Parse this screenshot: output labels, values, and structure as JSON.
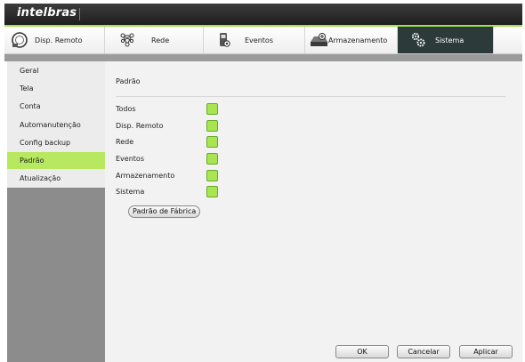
{
  "brand": {
    "logo": "intelbras"
  },
  "tabs": [
    {
      "label": "Disp. Remoto",
      "icon": "remote-device-icon"
    },
    {
      "label": "Rede",
      "icon": "network-icon"
    },
    {
      "label": "Eventos",
      "icon": "events-icon"
    },
    {
      "label": "Armazenamento",
      "icon": "storage-icon"
    },
    {
      "label": "Sistema",
      "icon": "gears-icon",
      "active": true
    }
  ],
  "sidebar": {
    "items": [
      {
        "label": "Geral"
      },
      {
        "label": "Tela"
      },
      {
        "label": "Conta"
      },
      {
        "label": "Automanutenção"
      },
      {
        "label": "Config backup"
      },
      {
        "label": "Padrão",
        "active": true
      },
      {
        "label": "Atualização"
      }
    ]
  },
  "main": {
    "title": "Padrão",
    "options": [
      {
        "label": "Todos",
        "checked": true
      },
      {
        "label": "Disp. Remoto",
        "checked": true
      },
      {
        "label": "Rede",
        "checked": true
      },
      {
        "label": "Eventos",
        "checked": true
      },
      {
        "label": "Armazenamento",
        "checked": true
      },
      {
        "label": "Sistema",
        "checked": true
      }
    ],
    "factory_button": "Padrão de Fábrica"
  },
  "footer": {
    "ok": "OK",
    "cancel": "Cancelar",
    "apply": "Aplicar"
  },
  "colors": {
    "accent": "#b7e85f",
    "checkbox": "#a9e551",
    "active_tab": "#2c3a3a"
  }
}
